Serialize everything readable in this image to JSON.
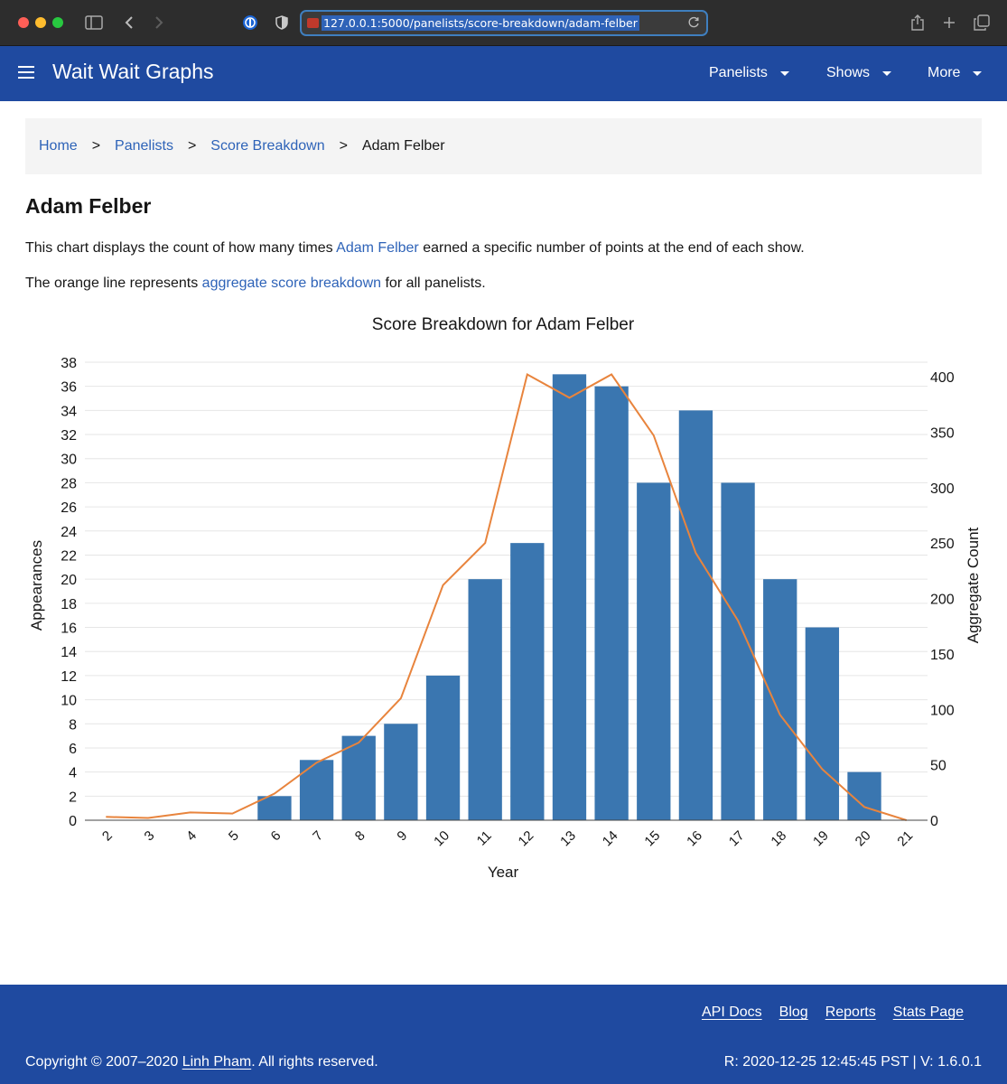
{
  "browser": {
    "url": "127.0.0.1:5000/panelists/score-breakdown/adam-felber"
  },
  "navbar": {
    "brand": "Wait Wait Graphs",
    "items": [
      {
        "label": "Panelists"
      },
      {
        "label": "Shows"
      },
      {
        "label": "More"
      }
    ]
  },
  "breadcrumb": {
    "items": [
      {
        "label": "Home"
      },
      {
        "label": "Panelists"
      },
      {
        "label": "Score Breakdown"
      }
    ],
    "separator": ">",
    "current": "Adam Felber"
  },
  "page": {
    "title": "Adam Felber",
    "para1_before": "This chart displays the count of how many times ",
    "para1_link": "Adam Felber",
    "para1_after": " earned a specific number of points at the end of each show.",
    "para2_before": "The orange line represents ",
    "para2_link": "aggregate score breakdown",
    "para2_after": " for all panelists."
  },
  "chart_data": {
    "type": "bar",
    "title": "Score Breakdown for Adam Felber",
    "xlabel": "Year",
    "ylabel": "Appearances",
    "y2label": "Aggregate Count",
    "categories": [
      "2",
      "3",
      "4",
      "5",
      "6",
      "7",
      "8",
      "9",
      "10",
      "11",
      "12",
      "13",
      "14",
      "15",
      "16",
      "17",
      "18",
      "19",
      "20",
      "21"
    ],
    "series": [
      {
        "type": "bar",
        "axis": "left",
        "color": "#3a76b0",
        "values": [
          0,
          0,
          0,
          0,
          2,
          5,
          7,
          8,
          12,
          20,
          23,
          37,
          36,
          28,
          34,
          28,
          20,
          16,
          4,
          0
        ]
      },
      {
        "type": "line",
        "axis": "right",
        "color": "#e8843d",
        "values": [
          3,
          2,
          7,
          6,
          24,
          52,
          70,
          110,
          212,
          250,
          402,
          381,
          402,
          347,
          241,
          180,
          95,
          46,
          12,
          0
        ]
      }
    ],
    "ylim": [
      0,
      38
    ],
    "y_ticks": [
      0,
      2,
      4,
      6,
      8,
      10,
      12,
      14,
      16,
      18,
      20,
      22,
      24,
      26,
      28,
      30,
      32,
      34,
      36,
      38
    ],
    "y2lim": [
      0,
      400
    ],
    "y2_ticks": [
      0,
      50,
      100,
      150,
      200,
      250,
      300,
      350,
      400
    ],
    "grid": true,
    "legend": false
  },
  "footer": {
    "links": [
      {
        "label": "API Docs"
      },
      {
        "label": "Blog"
      },
      {
        "label": "Reports"
      },
      {
        "label": "Stats Page"
      }
    ],
    "copyright_before": "Copyright © 2007–2020 ",
    "copyright_owner": "Linh Pham",
    "copyright_after": ". All rights reserved.",
    "revision": "R: 2020-12-25 12:45:45 PST | V: 1.6.0.1"
  }
}
